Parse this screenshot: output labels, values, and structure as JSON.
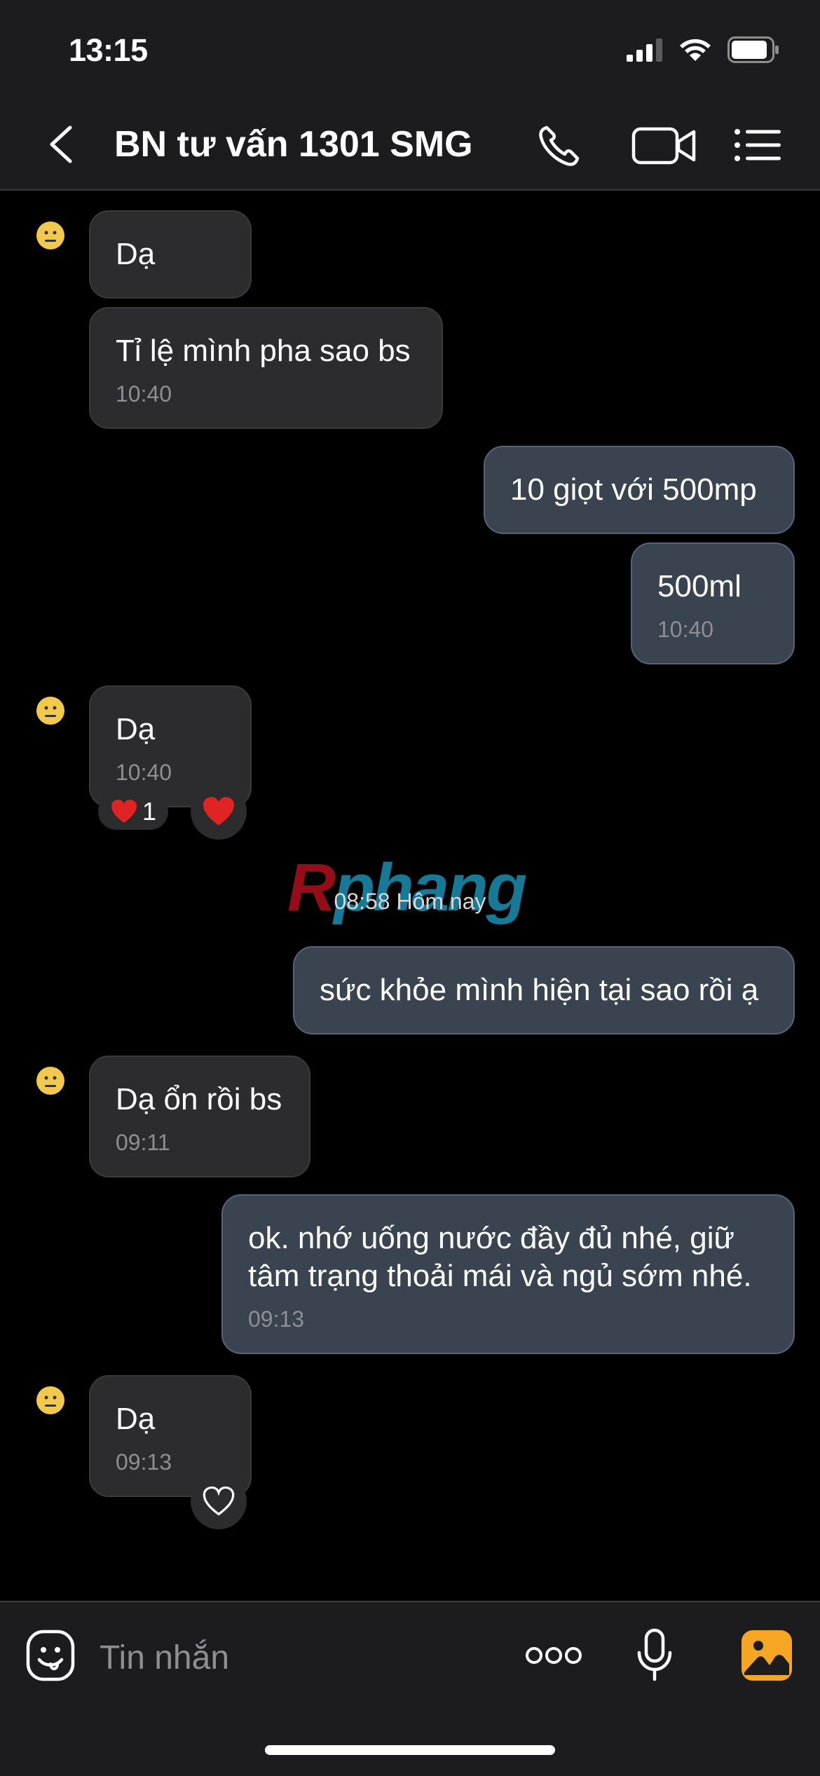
{
  "status": {
    "time": "13:15"
  },
  "header": {
    "title": "BN tư vấn 1301 SMG"
  },
  "messages": {
    "m1": {
      "text": "Dạ"
    },
    "m2": {
      "text": "Tỉ lệ mình pha sao bs",
      "time": "10:40"
    },
    "m3": {
      "text": "10 giọt với 500mp"
    },
    "m4": {
      "text": "500ml",
      "time": "10:40"
    },
    "m5": {
      "text": "Dạ",
      "time": "10:40",
      "reaction_count": "1"
    },
    "m6": {
      "text": "sức khỏe mình hiện tại sao rồi ạ"
    },
    "m7": {
      "text": "Dạ ổn rồi bs",
      "time": "09:11"
    },
    "m8": {
      "text": "ok. nhớ uống nước đầy đủ nhé, giữ tâm trạng thoải mái và ngủ sớm nhé.",
      "time": "09:13"
    },
    "m9": {
      "text": "Dạ",
      "time": "09:13"
    }
  },
  "date_separator": "08:58 Hôm nay",
  "watermark": {
    "r": "R",
    "rest": "phang"
  },
  "composer": {
    "placeholder": "Tin nhắn"
  },
  "colors": {
    "incoming_bubble": "#2c2c2e",
    "outgoing_bubble": "#3a4350",
    "accent_orange": "#f5a623",
    "heart_red": "#e02424"
  }
}
